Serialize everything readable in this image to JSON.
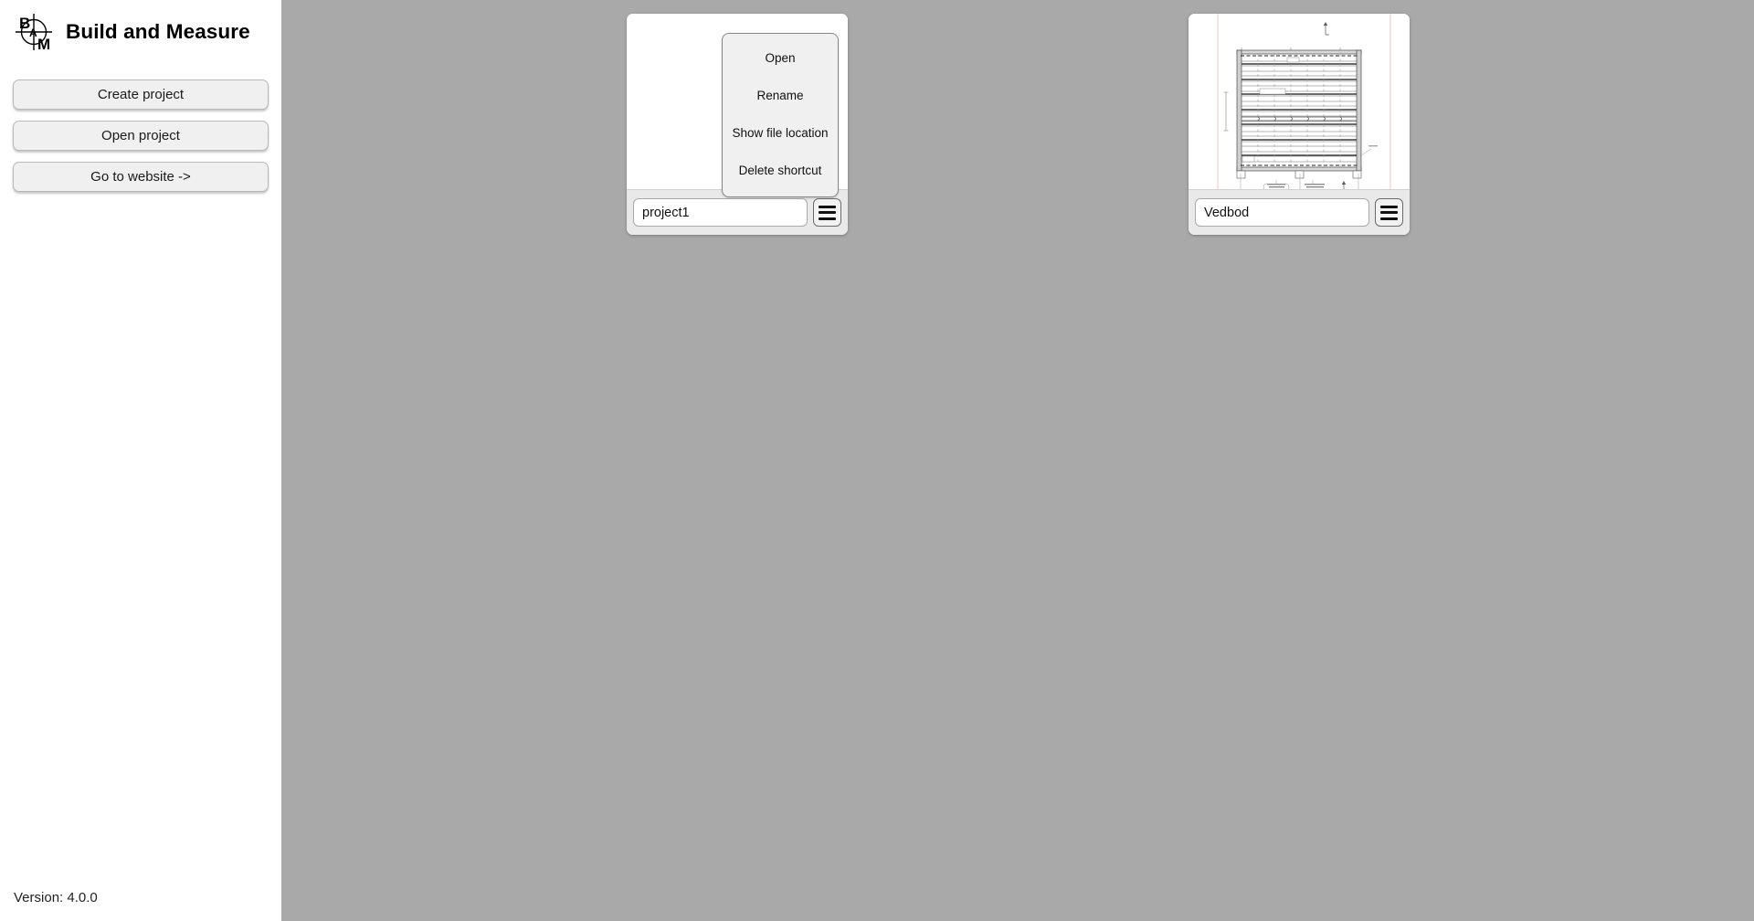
{
  "app": {
    "title": "Build and Measure",
    "logo_icon": "bam-crosshair-logo",
    "version_label": "Version: 4.0.0"
  },
  "sidebar": {
    "buttons": [
      {
        "id": "create-project",
        "label": "Create project"
      },
      {
        "id": "open-project",
        "label": "Open project"
      },
      {
        "id": "go-to-website",
        "label": "Go to website ->"
      }
    ]
  },
  "projects": [
    {
      "name": "project1",
      "menu_icon": "hamburger-menu-icon",
      "thumbnail": "empty",
      "menu_open": true
    },
    {
      "name": "Vedbod",
      "menu_icon": "hamburger-menu-icon",
      "thumbnail": "blueprint-joist-plan",
      "menu_open": false
    }
  ],
  "context_menu": {
    "items": [
      {
        "id": "open",
        "label": "Open"
      },
      {
        "id": "rename",
        "label": "Rename"
      },
      {
        "id": "show-file-location",
        "label": "Show file location"
      },
      {
        "id": "delete-shortcut",
        "label": "Delete shortcut"
      }
    ]
  },
  "colors": {
    "workspace_background": "#a9a9a9",
    "sidebar_background": "#ffffff",
    "button_face": "#f0f0f0",
    "card_footer": "#e9e9e9",
    "text": "#111111"
  }
}
